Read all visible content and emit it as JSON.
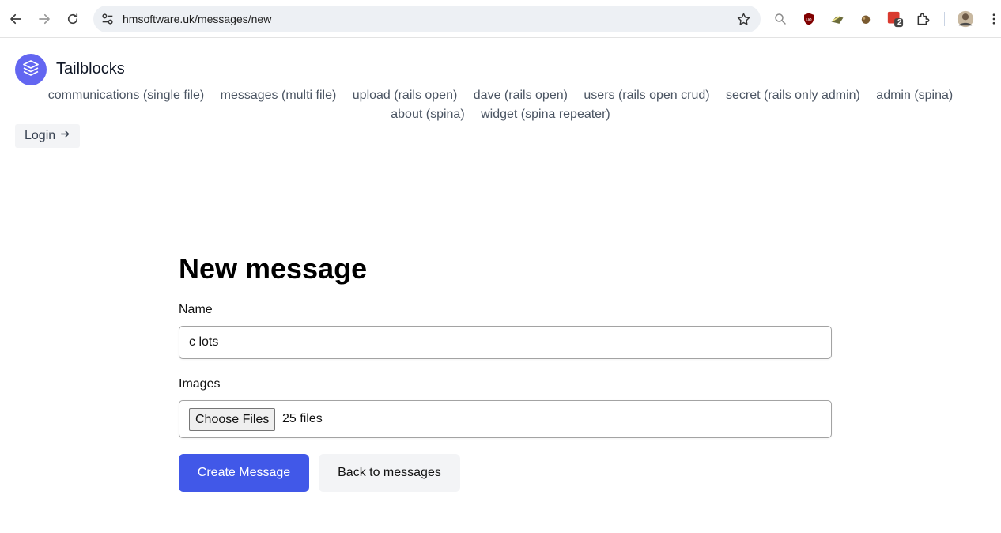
{
  "browser": {
    "url": "hmsoftware.uk/messages/new",
    "extension_badge": "2",
    "icons": [
      "back-arrow-icon",
      "forward-arrow-icon",
      "reload-icon",
      "site-info-icon",
      "bookmark-star-icon",
      "search-icon",
      "ublock-icon",
      "extension-icon",
      "extension-icon",
      "extension-icon",
      "puzzle-icon",
      "avatar",
      "kebab-menu-icon"
    ]
  },
  "header": {
    "brand": "Tailblocks",
    "logo_icon": "stack-layers-icon",
    "logo_color": "#6366f1",
    "nav_links": [
      "communications (single file)",
      "messages (multi file)",
      "upload (rails open)",
      "dave (rails open)",
      "users (rails open crud)",
      "secret (rails only admin)",
      "admin (spina)",
      "about (spina)",
      "widget (spina repeater)"
    ],
    "login_label": "Login"
  },
  "form": {
    "title": "New message",
    "name_label": "Name",
    "name_value": "c lots",
    "images_label": "Images",
    "choose_files_label": "Choose Files",
    "files_status": "25 files",
    "submit_label": "Create Message",
    "back_label": "Back to messages",
    "accent_color": "#4158e8"
  }
}
